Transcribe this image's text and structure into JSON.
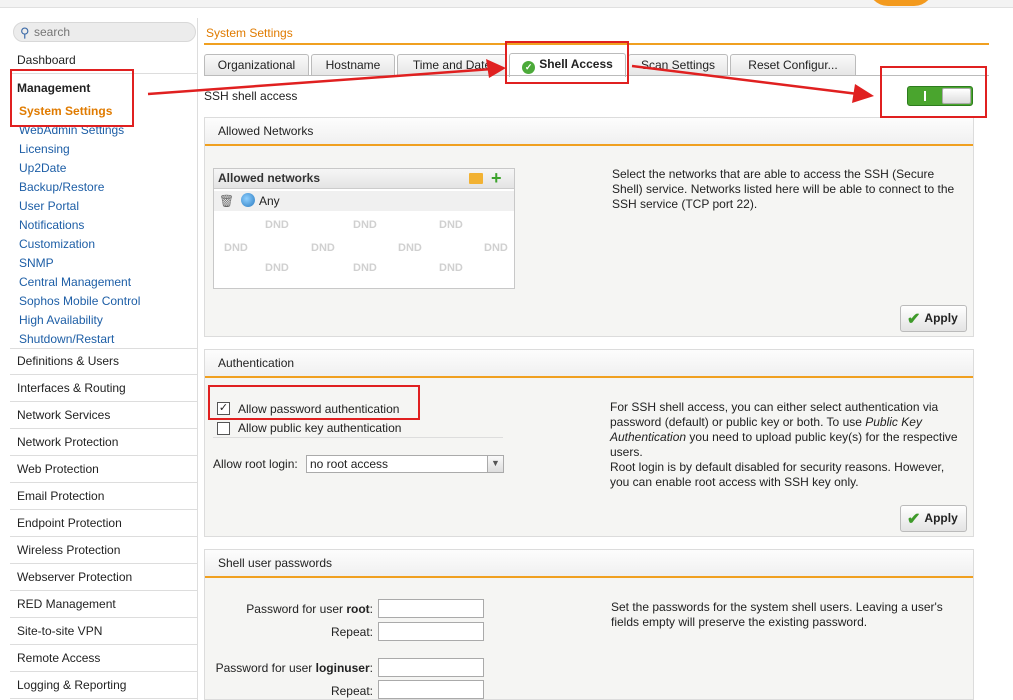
{
  "search": {
    "placeholder": "search"
  },
  "sidebar": {
    "dashboard": "Dashboard",
    "management": "Management",
    "active": "System Settings",
    "sub_items": [
      "WebAdmin Settings",
      "Licensing",
      "Up2Date",
      "Backup/Restore",
      "User Portal",
      "Notifications",
      "Customization",
      "SNMP",
      "Central Management",
      "Sophos Mobile Control",
      "High Availability",
      "Shutdown/Restart"
    ],
    "sections": [
      "Definitions & Users",
      "Interfaces & Routing",
      "Network Services",
      "Network Protection",
      "Web Protection",
      "Email Protection",
      "Endpoint Protection",
      "Wireless Protection",
      "Webserver Protection",
      "RED Management",
      "Site-to-site VPN",
      "Remote Access",
      "Logging & Reporting"
    ]
  },
  "breadcrumb": "System Settings",
  "tabs": [
    "Organizational",
    "Hostname",
    "Time and Date",
    "Shell Access",
    "Scan Settings",
    "Reset Configur..."
  ],
  "ssh_access": {
    "label": "SSH shell access",
    "enabled": true
  },
  "allowed_networks": {
    "title": "Allowed Networks",
    "box_title": "Allowed networks",
    "items": [
      "Any"
    ],
    "placeholder_text": "DND",
    "description": "Select the networks that are able to access the SSH (Secure Shell) service. Networks listed here will be able to connect to the SSH service (TCP port 22).",
    "apply_label": "Apply"
  },
  "authentication": {
    "title": "Authentication",
    "password_auth_label": "Allow password authentication",
    "password_auth_checked": true,
    "pubkey_auth_label": "Allow public key authentication",
    "pubkey_auth_checked": false,
    "root_login_label": "Allow root login:",
    "root_login_value": "no root access",
    "description_1": "For SSH shell access, you can either select authentication via password (default) or public key or both. To use ",
    "description_em": "Public Key Authentication",
    "description_2": " you need to upload public key(s) for the respective users.",
    "description_3": "Root login is by default disabled for security reasons. However, you can enable root access with SSH key only.",
    "apply_label": "Apply"
  },
  "shell_passwords": {
    "title": "Shell user passwords",
    "root_label_prefix": "Password for user ",
    "root_user": "root",
    "repeat_label": "Repeat:",
    "loginuser_label_prefix": "Password for user ",
    "login_user": "loginuser",
    "description": "Set the passwords for the system shell users. Leaving a user's fields empty will preserve the existing password."
  },
  "colors": {
    "accent": "#f0a020",
    "active_nav": "#e07b00",
    "link": "#1d5ea6",
    "toggle_on": "#4aa52e",
    "annotation": "#e02020"
  },
  "icons": [
    "search-icon",
    "checkmark-icon",
    "folder-icon",
    "plus-icon",
    "trash-icon",
    "globe-icon",
    "dropdown-arrow-icon"
  ]
}
